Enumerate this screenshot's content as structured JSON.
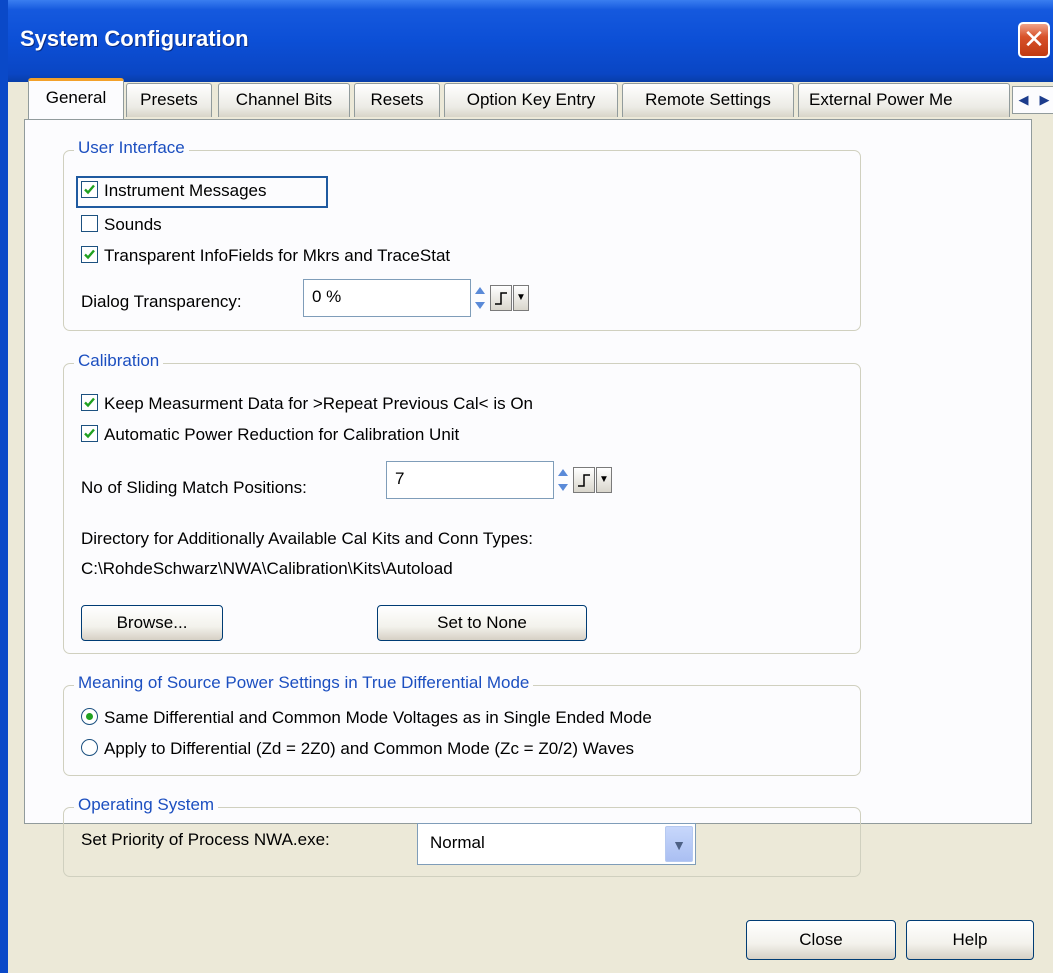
{
  "window": {
    "title": "System Configuration"
  },
  "tabs": [
    {
      "label": "General"
    },
    {
      "label": "Presets"
    },
    {
      "label": "Channel Bits"
    },
    {
      "label": "Resets"
    },
    {
      "label": "Option Key Entry"
    },
    {
      "label": "Remote Settings"
    },
    {
      "label": "External Power Me"
    }
  ],
  "user_interface": {
    "legend": "User Interface",
    "instrument_messages": {
      "label": "Instrument Messages",
      "checked": true
    },
    "sounds": {
      "label": "Sounds",
      "checked": false
    },
    "transparent_infofields": {
      "label": "Transparent InfoFields for Mkrs and TraceStat",
      "checked": true
    },
    "dialog_transparency_label": "Dialog Transparency:",
    "dialog_transparency_value": "0 %"
  },
  "calibration": {
    "legend": "Calibration",
    "keep_data": {
      "label": "Keep Measurment Data for >Repeat Previous Cal< is On",
      "checked": true
    },
    "auto_power": {
      "label": "Automatic Power Reduction for Calibration Unit",
      "checked": true
    },
    "sliding_label": "No of Sliding Match Positions:",
    "sliding_value": "7",
    "dir_label": "Directory for Additionally Available Cal Kits and Conn Types:",
    "dir_path": "C:\\RohdeSchwarz\\NWA\\Calibration\\Kits\\Autoload",
    "browse_label": "Browse...",
    "set_none_label": "Set to None"
  },
  "source_power": {
    "legend": "Meaning of Source Power Settings in True Differential Mode",
    "option1": {
      "label": "Same Differential and Common Mode Voltages as in Single Ended Mode",
      "selected": true
    },
    "option2": {
      "label": "Apply to Differential (Zd = 2Z0) and Common Mode (Zc = Z0/2) Waves",
      "selected": false
    }
  },
  "operating_system": {
    "legend": "Operating System",
    "priority_label": "Set Priority of Process NWA.exe:",
    "priority_value": "Normal"
  },
  "footer": {
    "close_label": "Close",
    "help_label": "Help"
  },
  "colors": {
    "title_bar": "#0c4fd6",
    "legend_text": "#1c4fc0",
    "check_mark": "#21a121"
  }
}
